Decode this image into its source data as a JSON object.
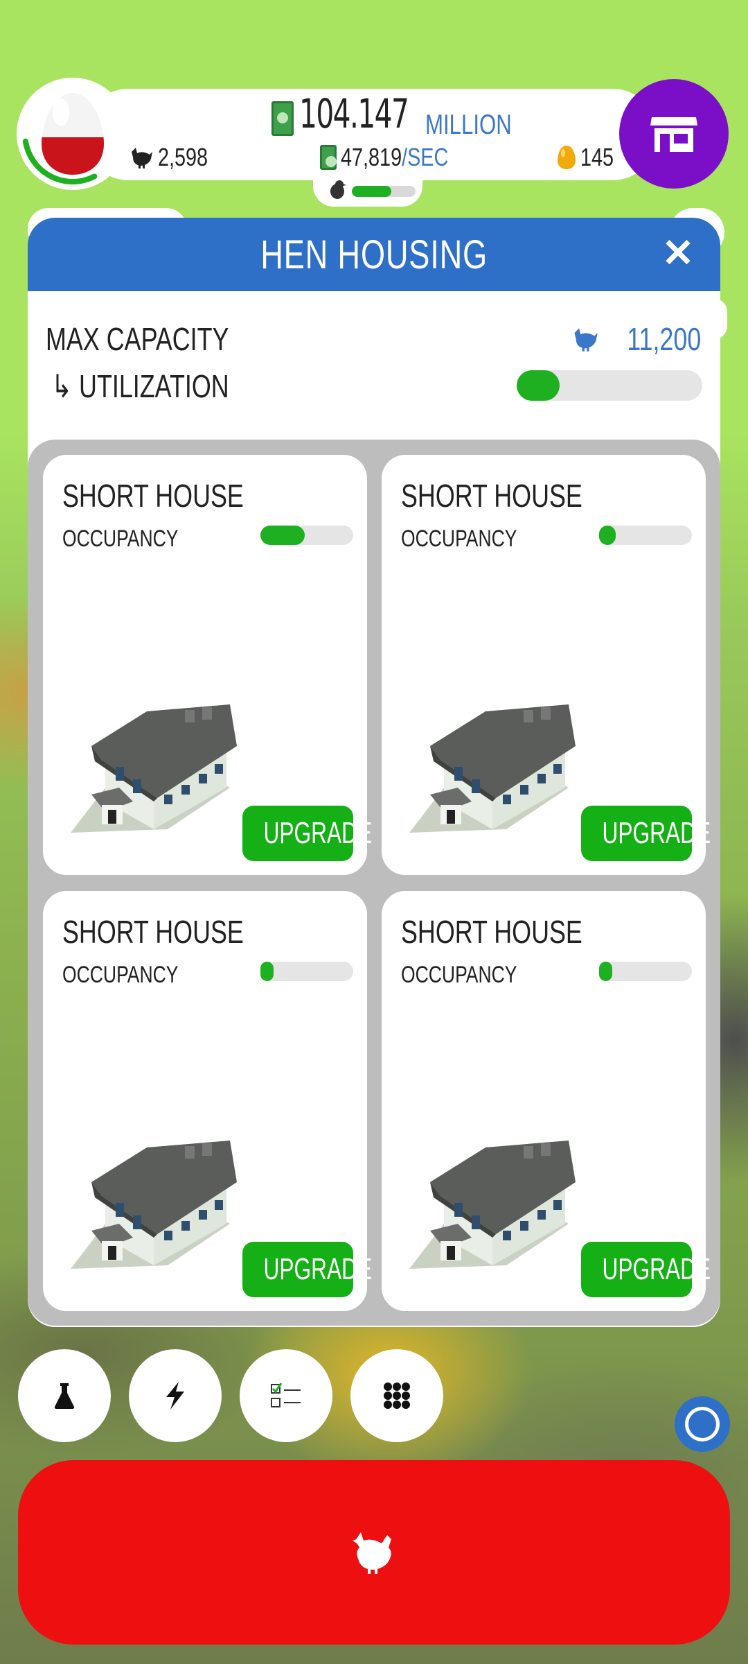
{
  "hud": {
    "money_value": "104.147",
    "money_unit": "MILLION",
    "hen_count": "2,598",
    "earning_rate": "47,819",
    "earning_rate_unit": "/SEC",
    "golden_eggs": "145",
    "hatch_progress": 0.62,
    "egg_ring_progress": 0.3
  },
  "panel": {
    "title": "HEN HOUSING",
    "max_capacity_label": "MAX CAPACITY",
    "max_capacity_value": "11,200",
    "utilization_label": "↳ UTILIZATION",
    "utilization": 0.23
  },
  "houses": [
    {
      "name": "SHORT HOUSE",
      "occupancy_label": "OCCUPANCY",
      "occupancy": 0.48,
      "upgrade_label": "UPGRADE"
    },
    {
      "name": "SHORT HOUSE",
      "occupancy_label": "OCCUPANCY",
      "occupancy": 0.18,
      "upgrade_label": "UPGRADE"
    },
    {
      "name": "SHORT HOUSE",
      "occupancy_label": "OCCUPANCY",
      "occupancy": 0.12,
      "upgrade_label": "UPGRADE"
    },
    {
      "name": "SHORT HOUSE",
      "occupancy_label": "OCCUPANCY",
      "occupancy": 0.12,
      "upgrade_label": "UPGRADE"
    }
  ],
  "bottom_buttons": [
    {
      "icon": "flask-icon"
    },
    {
      "icon": "lightning-icon"
    },
    {
      "icon": "checklist-icon"
    },
    {
      "icon": "grid-menu-icon"
    }
  ],
  "colors": {
    "accent_blue": "#2e6fc7",
    "green": "#1fb021",
    "shop_purple": "#7b0fc7",
    "hatch_red": "#ee0f10",
    "background_green": "#a9e460"
  }
}
